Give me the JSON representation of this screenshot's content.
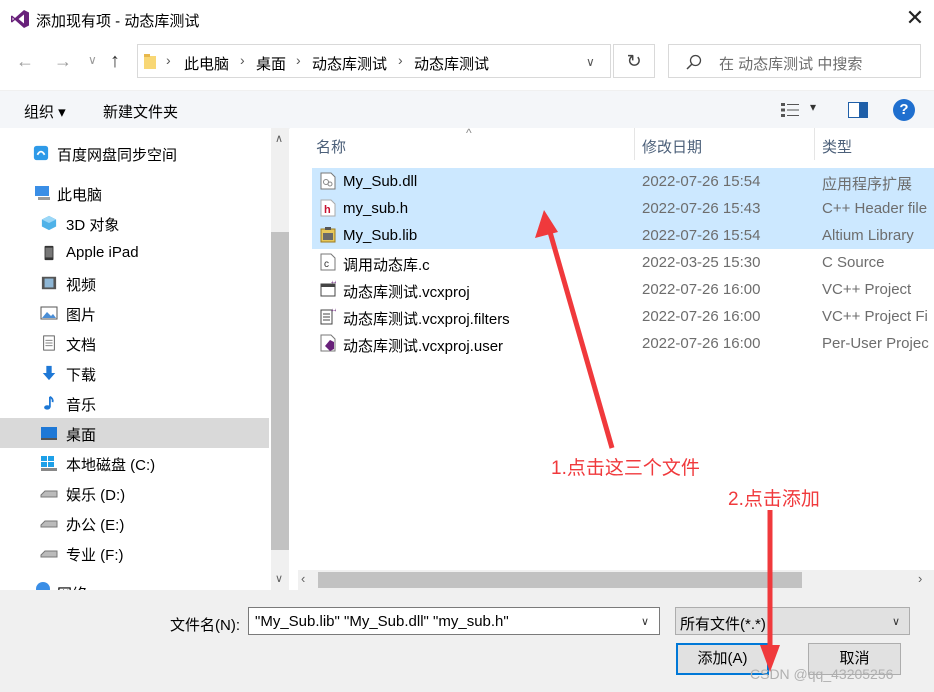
{
  "window": {
    "title": "添加现有项 - 动态库测试",
    "close_glyph": "✕"
  },
  "nav": {
    "back_glyph": "←",
    "forward_glyph": "→",
    "recent_glyph": "∨",
    "up_glyph": "↑",
    "breadcrumbs": [
      "此电脑",
      "桌面",
      "动态库测试",
      "动态库测试"
    ],
    "crumb_sep": "›",
    "dropdown_glyph": "∨",
    "refresh_glyph": "↻",
    "search_placeholder": "在 动态库测试 中搜索"
  },
  "toolbar": {
    "organize_label": "组织 ▾",
    "new_folder_label": "新建文件夹",
    "view_dropdown_glyph": "▾",
    "help_glyph": "?"
  },
  "sidebar": {
    "items": [
      {
        "label": "百度网盘同步空间",
        "icon": "baidu-netdisk-icon"
      },
      {
        "label": "此电脑",
        "icon": "computer-icon"
      },
      {
        "label": "3D 对象",
        "icon": "3d-objects-icon"
      },
      {
        "label": "Apple iPad",
        "icon": "ipad-icon"
      },
      {
        "label": "视频",
        "icon": "video-icon"
      },
      {
        "label": "图片",
        "icon": "picture-icon"
      },
      {
        "label": "文档",
        "icon": "document-icon"
      },
      {
        "label": "下载",
        "icon": "download-icon"
      },
      {
        "label": "音乐",
        "icon": "music-icon"
      },
      {
        "label": "桌面",
        "icon": "desktop-icon",
        "selected": true
      },
      {
        "label": "本地磁盘 (C:)",
        "icon": "windows-drive-icon"
      },
      {
        "label": "娱乐 (D:)",
        "icon": "drive-icon"
      },
      {
        "label": "办公 (E:)",
        "icon": "drive-icon"
      },
      {
        "label": "专业 (F:)",
        "icon": "drive-icon"
      },
      {
        "label": "网络",
        "icon": "network-icon"
      }
    ]
  },
  "filelist": {
    "sort_glyph": "^",
    "columns": {
      "name": "名称",
      "date": "修改日期",
      "type": "类型"
    },
    "rows": [
      {
        "name": "My_Sub.dll",
        "date": "2022-07-26 15:54",
        "type": "应用程序扩展",
        "icon": "dll-file-icon",
        "selected": true
      },
      {
        "name": "my_sub.h",
        "date": "2022-07-26 15:43",
        "type": "C++ Header file",
        "icon": "header-file-icon",
        "selected": true
      },
      {
        "name": "My_Sub.lib",
        "date": "2022-07-26 15:54",
        "type": "Altium Library",
        "icon": "lib-file-icon",
        "selected": true
      },
      {
        "name": "调用动态库.c",
        "date": "2022-03-25 15:30",
        "type": "C Source",
        "icon": "c-source-file-icon",
        "selected": false
      },
      {
        "name": "动态库测试.vcxproj",
        "date": "2022-07-26 16:00",
        "type": "VC++ Project",
        "icon": "vcxproj-file-icon",
        "selected": false
      },
      {
        "name": "动态库测试.vcxproj.filters",
        "date": "2022-07-26 16:00",
        "type": "VC++ Project Fi",
        "icon": "filters-file-icon",
        "selected": false
      },
      {
        "name": "动态库测试.vcxproj.user",
        "date": "2022-07-26 16:00",
        "type": "Per-User Projec",
        "icon": "user-file-icon",
        "selected": false
      }
    ]
  },
  "bottom": {
    "filename_label": "文件名(N):",
    "filename_value": "\"My_Sub.lib\" \"My_Sub.dll\" \"my_sub.h\"",
    "filetype_value": "所有文件(*.*)",
    "add_label": "添加(A)",
    "cancel_label": "取消"
  },
  "annotations": {
    "step1": "1.点击这三个文件",
    "step2": "2.点击添加",
    "color": "#f0393c"
  },
  "watermark": "CSDN @qq_43205256",
  "colors": {
    "selection": "#cce8ff",
    "accent": "#0078d7",
    "vs_purple": "#68217a"
  }
}
